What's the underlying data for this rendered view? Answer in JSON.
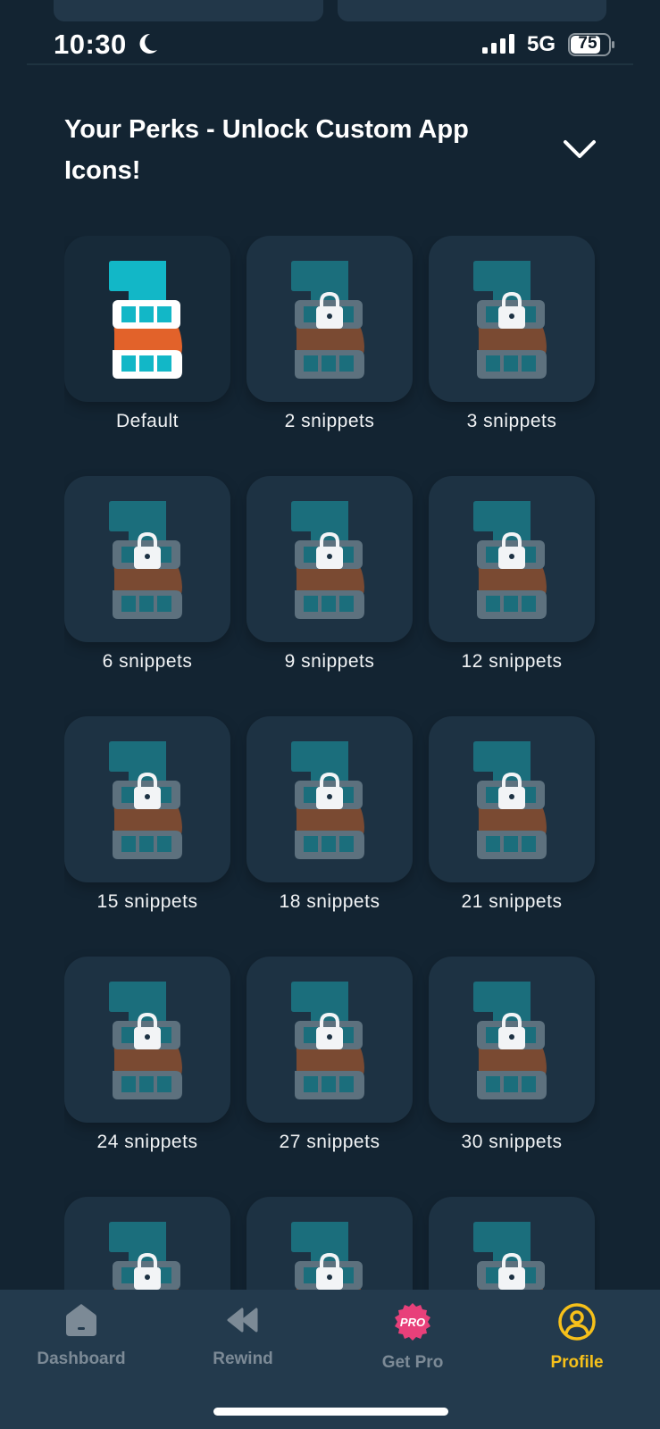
{
  "status": {
    "time": "10:30",
    "network": "5G",
    "battery": "75"
  },
  "section": {
    "title": "Your Perks - Unlock Custom App Icons!"
  },
  "icons": [
    {
      "label": "Default",
      "locked": false
    },
    {
      "label": "2 snippets",
      "locked": true
    },
    {
      "label": "3 snippets",
      "locked": true
    },
    {
      "label": "6 snippets",
      "locked": true
    },
    {
      "label": "9 snippets",
      "locked": true
    },
    {
      "label": "12 snippets",
      "locked": true
    },
    {
      "label": "15 snippets",
      "locked": true
    },
    {
      "label": "18 snippets",
      "locked": true
    },
    {
      "label": "21 snippets",
      "locked": true
    },
    {
      "label": "24 snippets",
      "locked": true
    },
    {
      "label": "27 snippets",
      "locked": true
    },
    {
      "label": "30 snippets",
      "locked": true
    },
    {
      "label": "",
      "locked": true
    },
    {
      "label": "",
      "locked": true
    },
    {
      "label": "",
      "locked": true
    }
  ],
  "tabs": [
    {
      "label": "Dashboard",
      "icon": "house-icon"
    },
    {
      "label": "Rewind",
      "icon": "rewind-icon"
    },
    {
      "label": "Get Pro",
      "icon": "pro-badge-icon",
      "badge": "PRO"
    },
    {
      "label": "Profile",
      "icon": "profile-icon"
    }
  ],
  "colors": {
    "background": "#132432",
    "accent": "#f6c01a",
    "logo_teal": "#12b7c7",
    "logo_orange": "#e2622a",
    "pro_badge": "#e8407a"
  }
}
